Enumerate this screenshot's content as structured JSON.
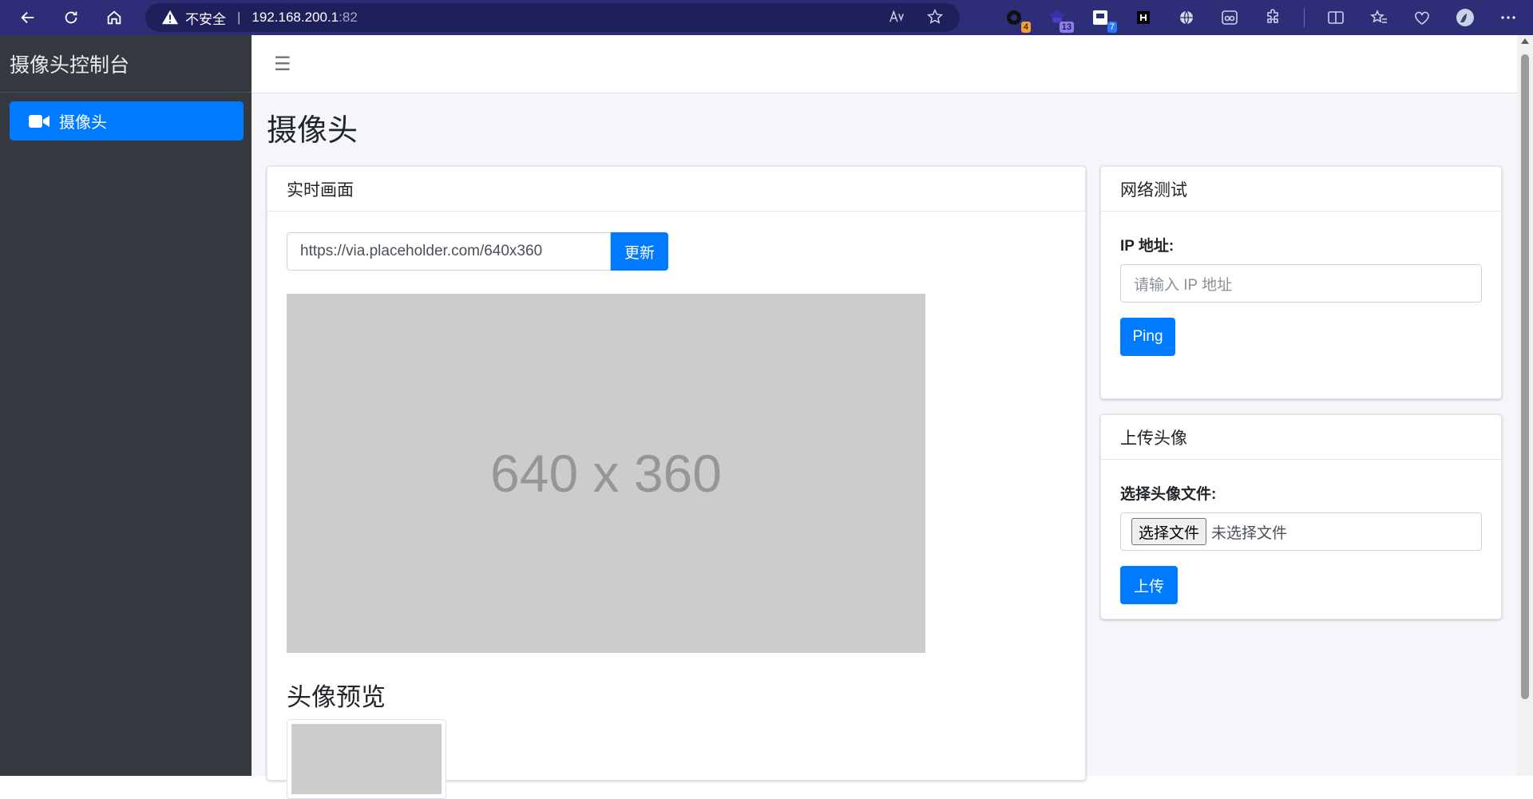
{
  "browser": {
    "insecure_label": "不安全",
    "host": "192.168.200.1",
    "port": ":82",
    "extensions": [
      {
        "name": "ext-1",
        "badge": "4",
        "badge_color": "#f0a030"
      },
      {
        "name": "ext-2",
        "badge": "13",
        "badge_color": "#8a7cf0"
      },
      {
        "name": "ext-3",
        "badge": "7",
        "badge_color": "#2a7af5"
      }
    ]
  },
  "sidebar": {
    "brand": "摄像头控制台",
    "items": [
      {
        "label": "摄像头",
        "icon": "video-camera-icon",
        "active": true
      }
    ]
  },
  "page": {
    "title": "摄像头"
  },
  "live_card": {
    "title": "实时画面",
    "url_value": "https://via.placeholder.com/640x360",
    "refresh_label": "更新",
    "image_text": "640 x 360",
    "preview_title": "头像预览"
  },
  "network_card": {
    "title": "网络测试",
    "ip_label": "IP 地址:",
    "ip_placeholder": "请输入 IP 地址",
    "ping_label": "Ping"
  },
  "upload_card": {
    "title": "上传头像",
    "file_label": "选择头像文件:",
    "choose_file_label": "选择文件",
    "no_file_text": "未选择文件",
    "upload_label": "上传"
  },
  "colors": {
    "primary": "#007bff",
    "sidebar_bg": "#343a40",
    "browser_bar": "#2d2d78"
  }
}
